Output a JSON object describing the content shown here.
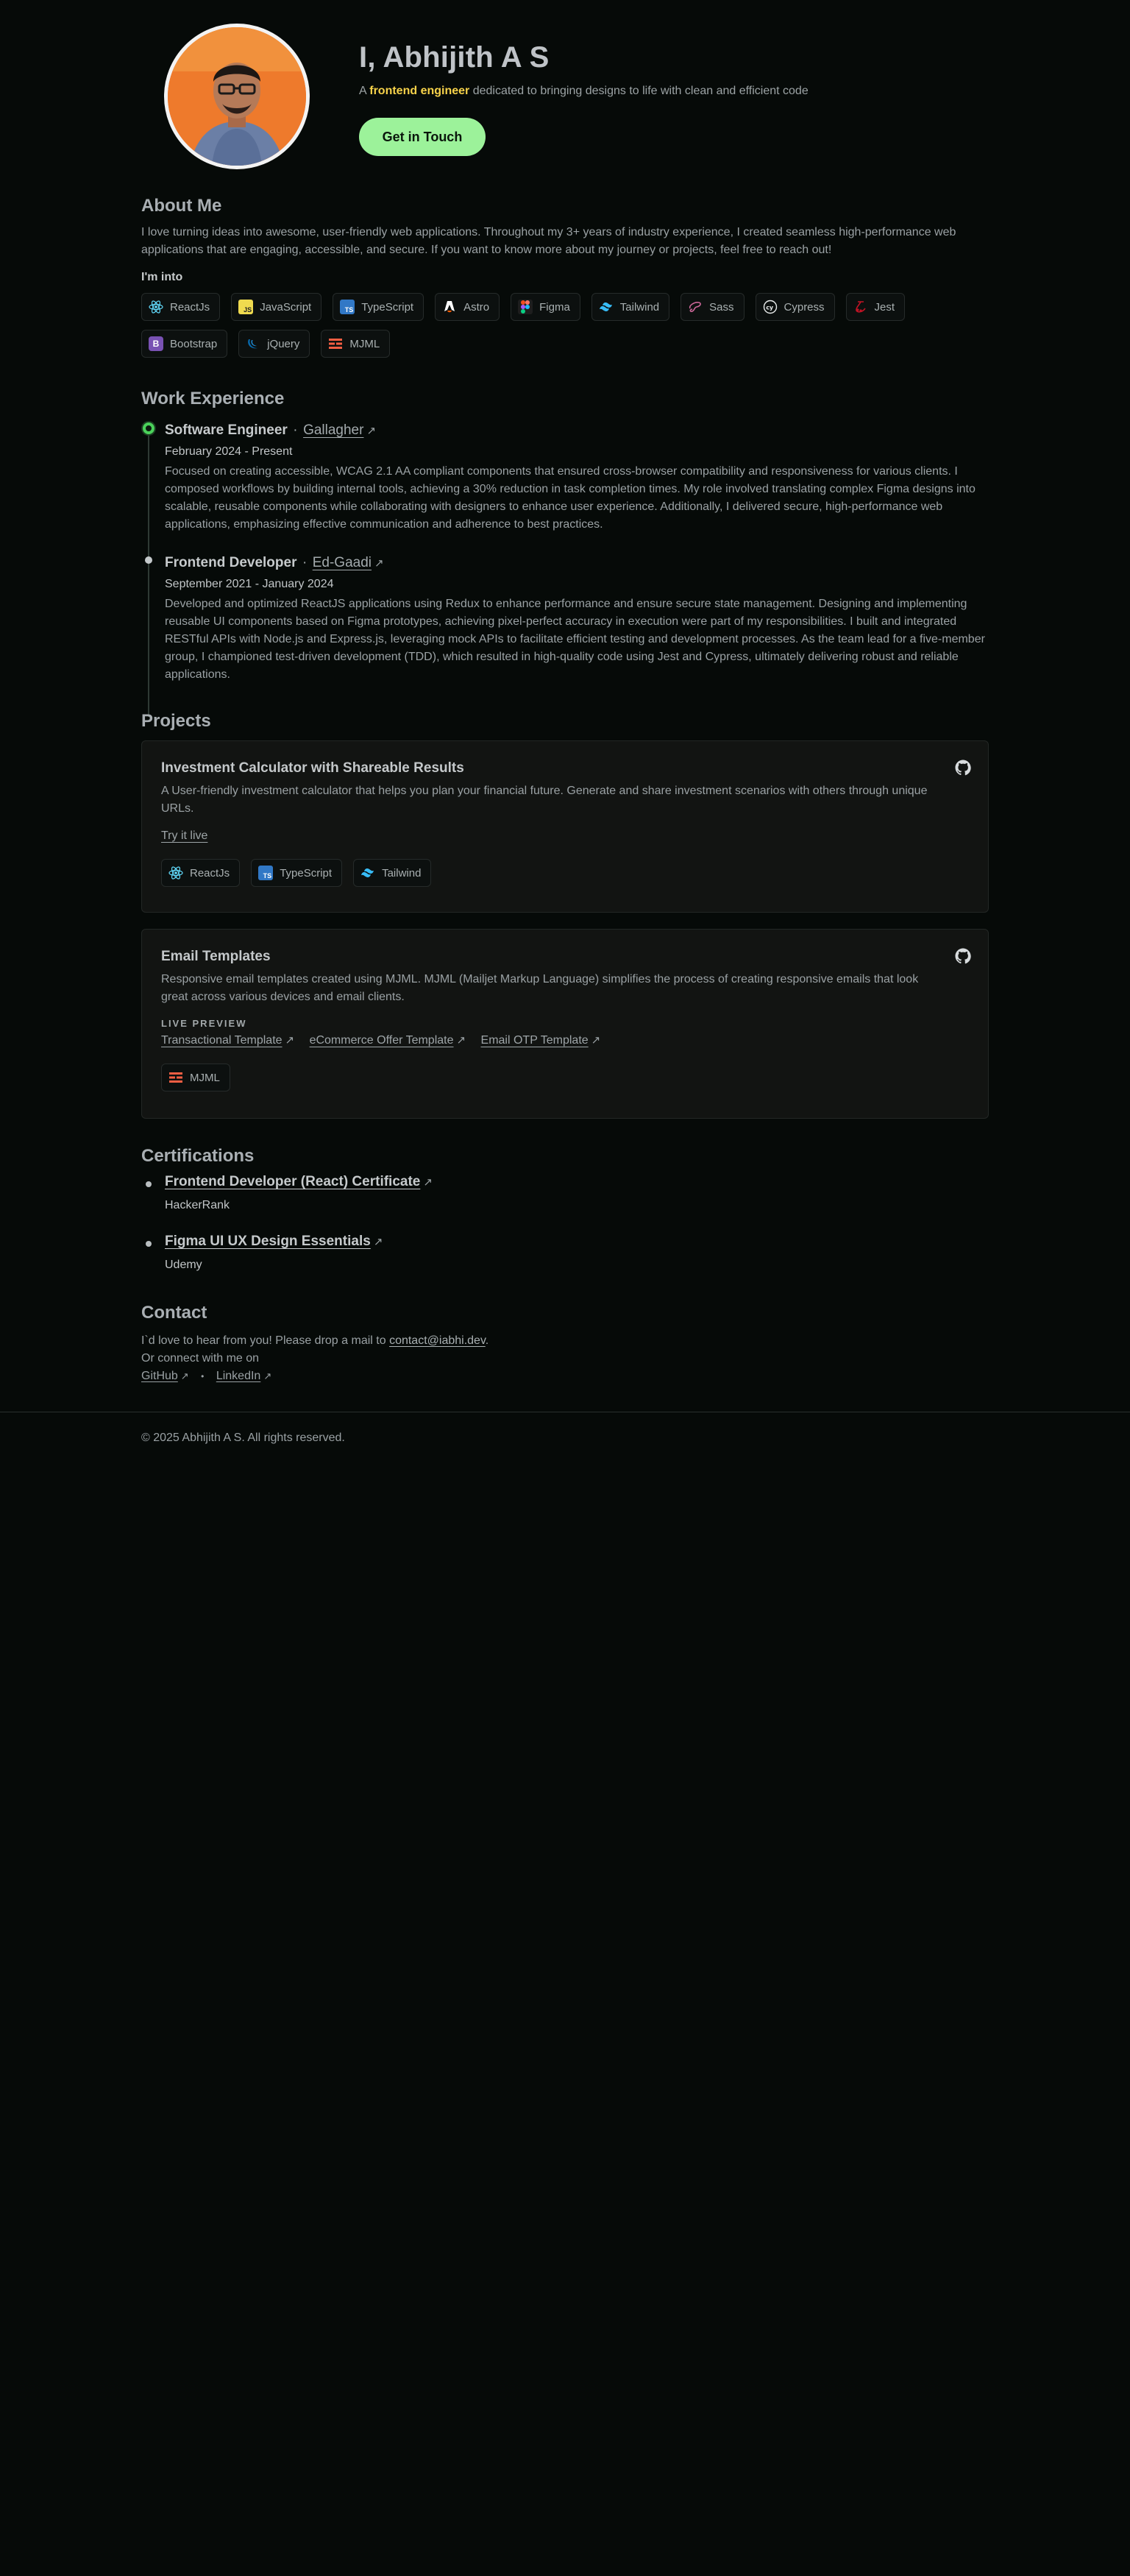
{
  "hero": {
    "name": "I, Abhijith A S",
    "sub_prefix": "A",
    "sub_highlight": "frontend engineer",
    "sub_suffix": "dedicated to bringing designs to life with clean and efficient code",
    "cta_label": "Get in Touch"
  },
  "about": {
    "title": "About Me",
    "text": "I love turning ideas into awesome, user-friendly web applications. Throughout my 3+ years of industry experience, I created seamless high-performance web applications that are engaging, accessible, and secure. If you want to know more about my journey or projects, feel free to reach out!",
    "into_label": "I'm into",
    "skills": [
      {
        "label": "ReactJs",
        "icon": "react-icon"
      },
      {
        "label": "JavaScript",
        "icon": "javascript-icon"
      },
      {
        "label": "TypeScript",
        "icon": "typescript-icon"
      },
      {
        "label": "Astro",
        "icon": "astro-icon"
      },
      {
        "label": "Figma",
        "icon": "figma-icon"
      },
      {
        "label": "Tailwind",
        "icon": "tailwind-icon"
      },
      {
        "label": "Sass",
        "icon": "sass-icon"
      },
      {
        "label": "Cypress",
        "icon": "cypress-icon"
      },
      {
        "label": "Jest",
        "icon": "jest-icon"
      },
      {
        "label": "Bootstrap",
        "icon": "bootstrap-icon"
      },
      {
        "label": "jQuery",
        "icon": "jquery-icon"
      },
      {
        "label": "MJML",
        "icon": "mjml-icon"
      }
    ]
  },
  "experience": {
    "title": "Work Experience",
    "jobs": [
      {
        "role": "Software Engineer",
        "separator": "·",
        "company": "Gallagher",
        "dates": "February 2024 - Present",
        "description": "Focused on creating accessible, WCAG 2.1 AA compliant components that ensured cross-browser compatibility and responsiveness for various clients. I composed workflows by building internal tools, achieving a 30% reduction in task completion times. My role involved translating complex Figma designs into scalable, reusable components while collaborating with designers to enhance user experience. Additionally, I delivered secure, high-performance web applications, emphasizing effective communication and adherence to best practices."
      },
      {
        "role": "Frontend Developer",
        "separator": "·",
        "company": "Ed-Gaadi",
        "dates": "September 2021 - January 2024",
        "description": "Developed and optimized ReactJS applications using Redux to enhance performance and ensure secure state management. Designing and implementing reusable UI components based on Figma prototypes, achieving pixel-perfect accuracy in execution were part of my responsibilities. I built and integrated RESTful APIs with Node.js and Express.js, leveraging mock APIs to facilitate efficient testing and development processes. As the team lead for a five-member group, I championed test-driven development (TDD), which resulted in high-quality code using Jest and Cypress, ultimately delivering robust and reliable applications."
      }
    ]
  },
  "projects": {
    "title": "Projects",
    "items": [
      {
        "title": "Investment Calculator with Shareable Results",
        "description": "A User-friendly investment calculator that helps you plan your financial future. Generate and share investment scenarios with others through unique URLs.",
        "link_label": "Try it live",
        "tags": [
          {
            "label": "ReactJs",
            "icon": "react-icon"
          },
          {
            "label": "TypeScript",
            "icon": "typescript-icon"
          },
          {
            "label": "Tailwind",
            "icon": "tailwind-icon"
          }
        ]
      },
      {
        "title": "Email Templates",
        "description": "Responsive email templates created using MJML. MJML (Mailjet Markup Language) simplifies the process of creating responsive emails that look great across various devices and email clients.",
        "preview_label": "LIVE PREVIEW",
        "links": [
          "Transactional Template",
          "eCommerce Offer Template",
          "Email OTP Template"
        ],
        "tags": [
          {
            "label": "MJML",
            "icon": "mjml-icon"
          }
        ]
      }
    ]
  },
  "certifications": {
    "title": "Certifications",
    "items": [
      {
        "title": "Frontend Developer (React) Certificate",
        "issuer": "HackerRank"
      },
      {
        "title": "Figma UI UX Design Essentials",
        "issuer": "Udemy"
      }
    ]
  },
  "contact": {
    "title": "Contact",
    "line1_prefix": "I`d love to hear from you! Please drop a mail to",
    "email": "contact@iabhi.dev",
    "line1_suffix": ".",
    "line2": "Or connect with me on",
    "github": "GitHub",
    "dot": "•",
    "linkedin": "LinkedIn"
  },
  "footer": {
    "text": "© 2025 Abhijith A S. All rights reserved."
  },
  "colors": {
    "background": "#060a08",
    "accent_green": "#9cf29a",
    "highlight_yellow": "#f6d24a"
  }
}
